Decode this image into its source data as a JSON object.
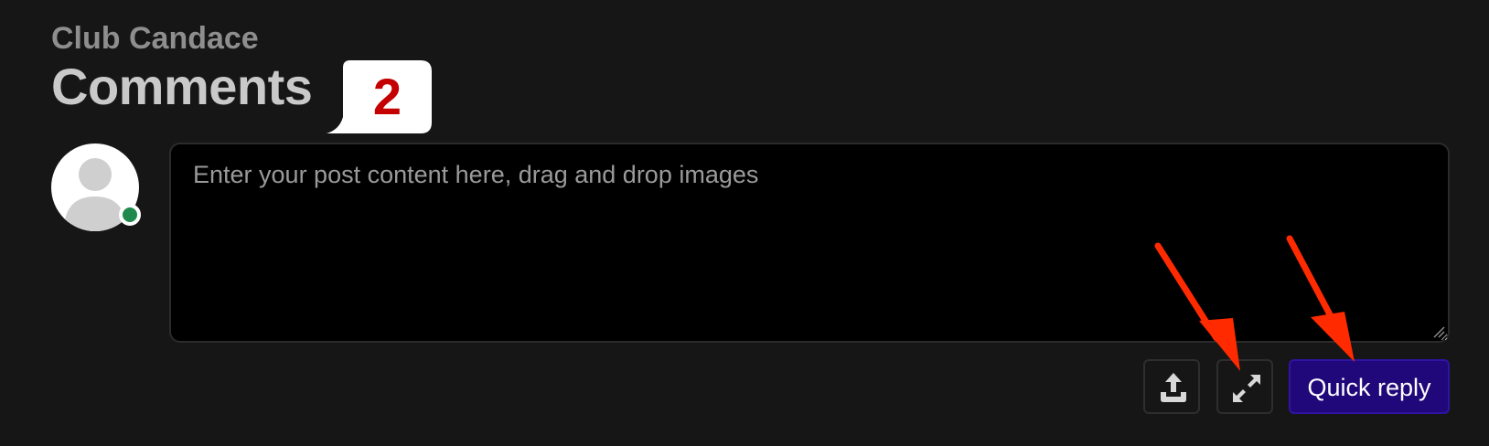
{
  "header": {
    "club_name": "Club Candace",
    "title": "Comments",
    "comment_count": "2"
  },
  "composer": {
    "placeholder": "Enter your post content here, drag and drop images",
    "value": "",
    "user_status": "online"
  },
  "actions": {
    "upload_icon": "upload-icon",
    "expand_icon": "expand-icon",
    "quick_reply_label": "Quick reply"
  },
  "annotations": {
    "arrow_color": "#ff2a00",
    "targets": [
      "expand-button",
      "quick-reply-button"
    ]
  },
  "colors": {
    "background": "#161616",
    "accent_button": "#21087a",
    "badge_number": "#c40000",
    "online": "#1f8a4c"
  }
}
